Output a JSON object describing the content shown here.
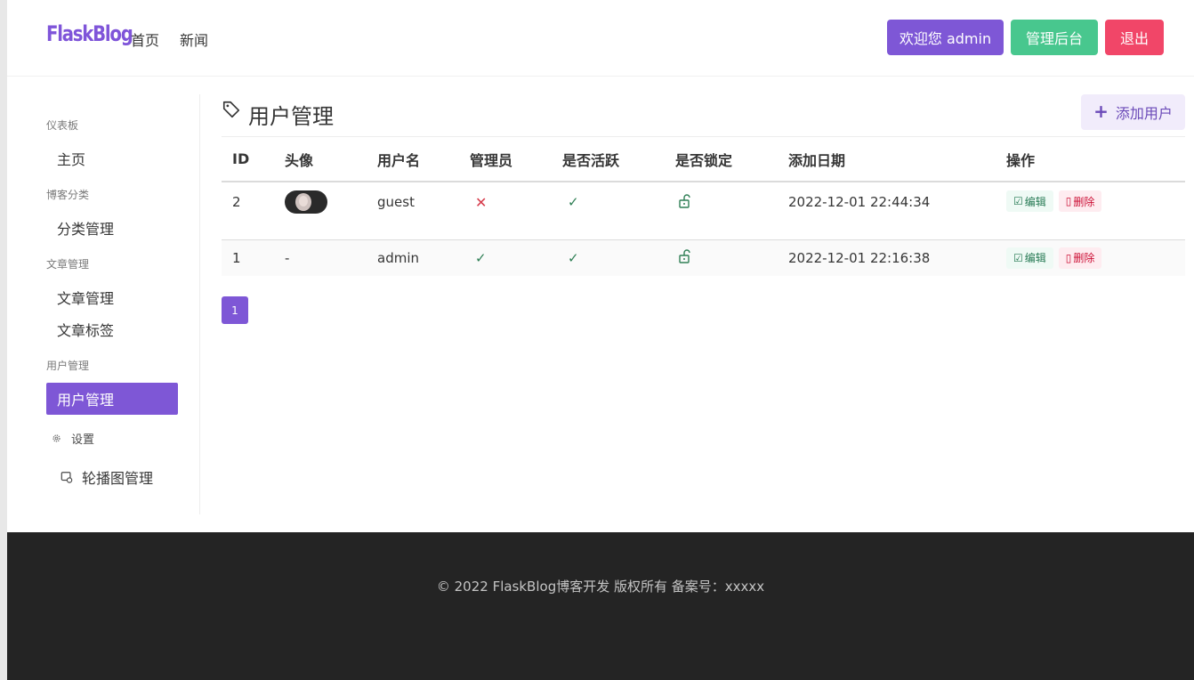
{
  "brand": "FlaskBlog",
  "nav": {
    "home": "首页",
    "news": "新闻"
  },
  "header_buttons": {
    "welcome": "欢迎您 admin",
    "admin": "管理后台",
    "logout": "退出"
  },
  "sidebar": {
    "groups": [
      {
        "label": "仪表板",
        "items": [
          "主页"
        ]
      },
      {
        "label": "博客分类",
        "items": [
          "分类管理"
        ]
      },
      {
        "label": "文章管理",
        "items": [
          "文章管理",
          "文章标签"
        ]
      },
      {
        "label": "用户管理",
        "items": [
          "用户管理"
        ]
      }
    ],
    "active": "用户管理",
    "settings_label": "设置",
    "settings_items": [
      "轮播图管理"
    ]
  },
  "main": {
    "title": "用户管理",
    "add_button": "添加用户",
    "columns": [
      "ID",
      "头像",
      "用户名",
      "管理员",
      "是否活跃",
      "是否锁定",
      "添加日期",
      "操作"
    ],
    "rows": [
      {
        "id": "2",
        "avatar": "image",
        "username": "guest",
        "is_admin": false,
        "is_active": true,
        "is_locked": false,
        "created": "2022-12-01 22:44:34",
        "edit": "编辑",
        "delete": "删除"
      },
      {
        "id": "1",
        "avatar": "-",
        "username": "admin",
        "is_admin": true,
        "is_active": true,
        "is_locked": false,
        "created": "2022-12-01 22:16:38",
        "edit": "编辑",
        "delete": "删除"
      }
    ],
    "pagination": [
      "1"
    ]
  },
  "footer": "© 2022 FlaskBlog博客开发 版权所有 备案号：xxxxx",
  "colors": {
    "primary": "#7e57d6",
    "success": "#48c78e",
    "danger": "#f14668",
    "footer_bg": "#242424"
  }
}
